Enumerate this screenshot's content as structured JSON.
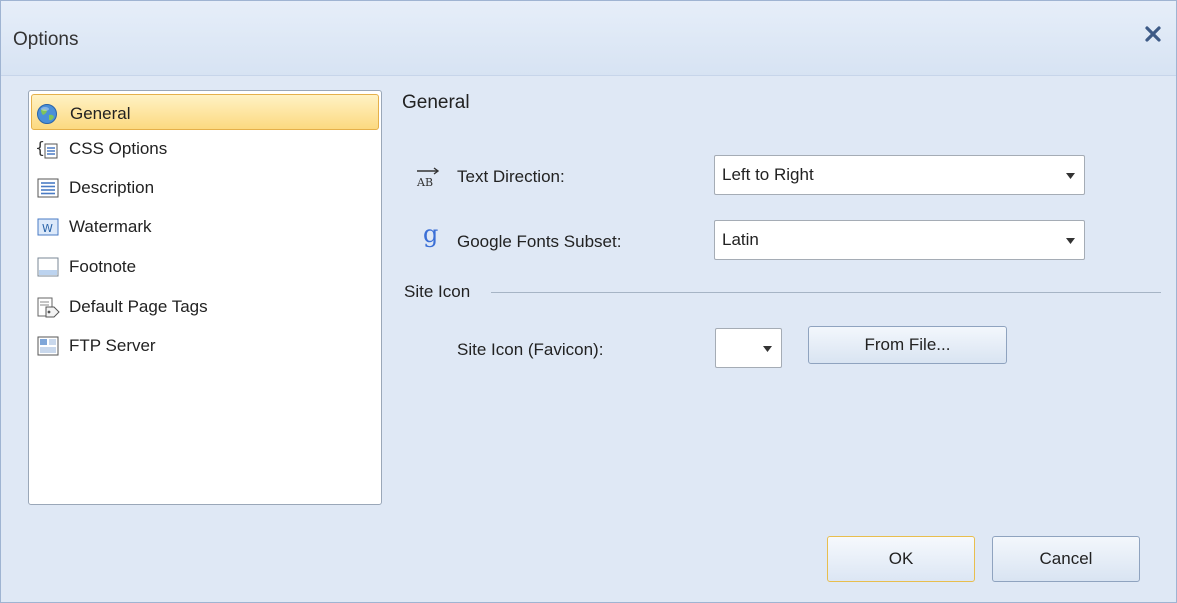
{
  "window": {
    "title": "Options"
  },
  "nav": {
    "items": [
      {
        "label": "General",
        "icon": "globe-icon",
        "selected": true
      },
      {
        "label": "CSS Options",
        "icon": "css-braces-icon",
        "selected": false
      },
      {
        "label": "Description",
        "icon": "document-lines-icon",
        "selected": false
      },
      {
        "label": "Watermark",
        "icon": "watermark-w-icon",
        "selected": false
      },
      {
        "label": "Footnote",
        "icon": "footnote-icon",
        "selected": false
      },
      {
        "label": "Default Page Tags",
        "icon": "tag-page-icon",
        "selected": false
      },
      {
        "label": "FTP Server",
        "icon": "ftp-server-icon",
        "selected": false
      }
    ]
  },
  "general": {
    "title": "General",
    "text_direction": {
      "label": "Text Direction:",
      "value": "Left to Right",
      "icon": "text-direction-icon"
    },
    "google_fonts": {
      "label": "Google Fonts Subset:",
      "value": "Latin",
      "icon": "google-g-icon"
    },
    "site_icon": {
      "group_label": "Site Icon",
      "label": "Site Icon (Favicon):",
      "value": "",
      "from_file_label": "From File..."
    }
  },
  "footer": {
    "ok_label": "OK",
    "cancel_label": "Cancel"
  },
  "colors": {
    "background": "#dfe8f5",
    "selection_fill": "#fcd980",
    "selection_border": "#e5b04a",
    "default_button_border": "#e8be4e"
  }
}
